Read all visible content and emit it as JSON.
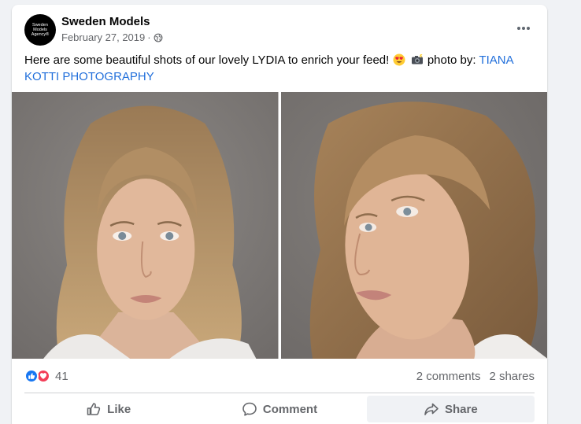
{
  "post": {
    "author": "Sweden Models",
    "avatar_text": [
      "Sweden",
      "Models",
      "Agency®"
    ],
    "date": "February 27, 2019",
    "separator": "·",
    "privacy_icon": "globe-icon",
    "text_before": "Here are some beautiful shots of our lovely LYDIA to enrich your feed!",
    "emojis": [
      "heart-eyes-emoji",
      "camera-with-flash-emoji"
    ],
    "text_middle": "photo by:",
    "link_text": "TIANA KOTTI PHOTOGRAPHY",
    "photos": [
      "photo-lydia-front",
      "photo-lydia-side"
    ]
  },
  "stats": {
    "reaction_icons": [
      "like-reaction-icon",
      "love-reaction-icon"
    ],
    "reaction_count": "41",
    "comments": "2 comments",
    "shares": "2 shares"
  },
  "actions": {
    "like": "Like",
    "comment": "Comment",
    "share": "Share"
  },
  "colors": {
    "link": "#216fdb",
    "like_blue": "#1877f2",
    "love_red": "#f33e58",
    "secondary_text": "#65676b"
  }
}
